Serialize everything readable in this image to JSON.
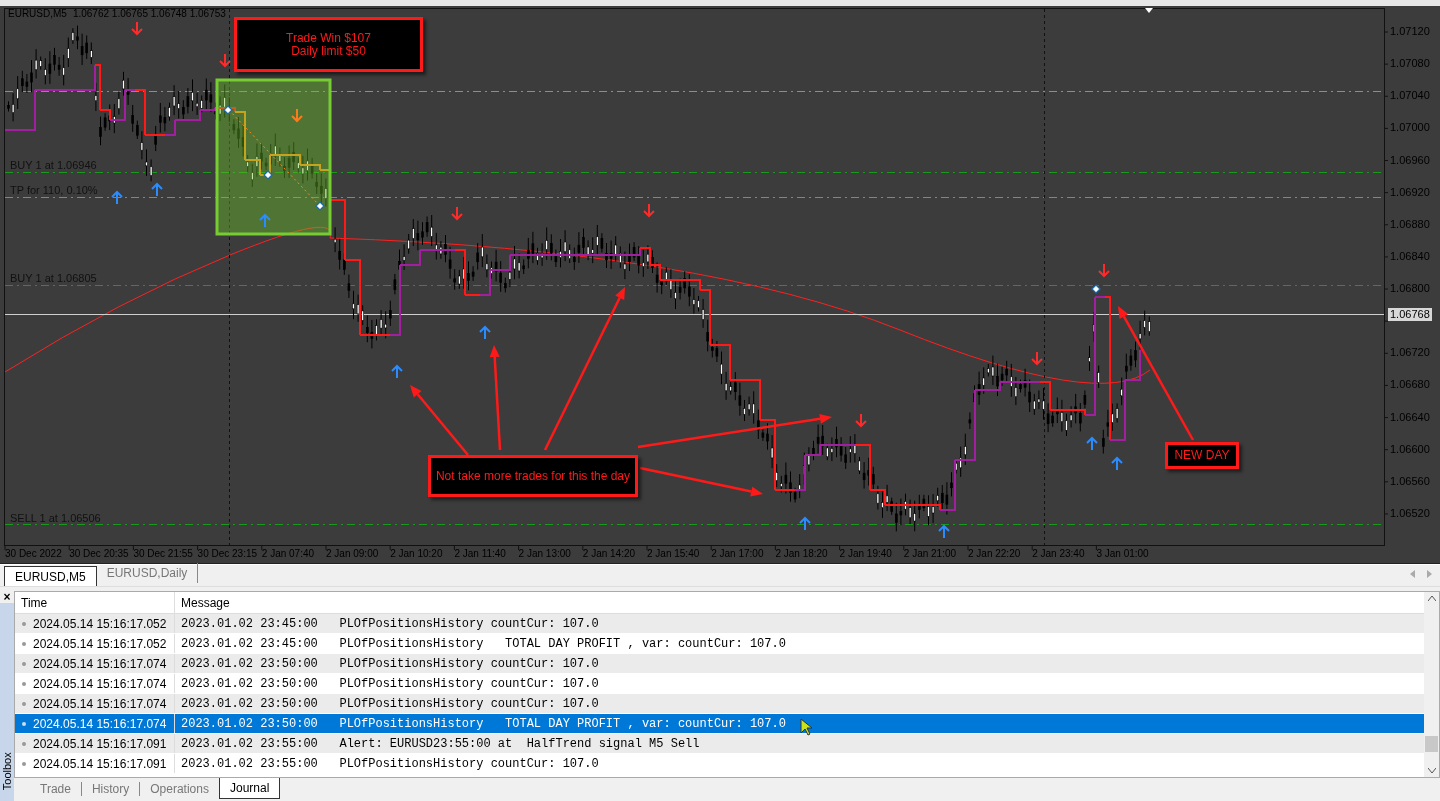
{
  "chart": {
    "symbol": "EURUSD,M5",
    "ohlc": "1.06762 1.06765 1.06748 1.06753",
    "line_labels": [
      "BUY 1 at 1.06946",
      "TP for 110, 0.10%",
      "BUY 1 at 1.06805",
      "SELL 1 at 1.06506"
    ],
    "price_labels": [
      "1.07120",
      "1.07080",
      "1.07040",
      "1.07000",
      "1.06960",
      "1.06920",
      "1.06880",
      "1.06840",
      "1.06800",
      "1.06720",
      "1.06680",
      "1.06640",
      "1.06600",
      "1.06560",
      "1.06520"
    ],
    "current_price": "1.06768",
    "time_labels": [
      "30 Dec 2022",
      "30 Dec 20:35",
      "30 Dec 21:55",
      "30 Dec 23:15",
      "2 Jan 07:40",
      "2 Jan 09:00",
      "2 Jan 10:20",
      "2 Jan 11:40",
      "2 Jan 13:00",
      "2 Jan 14:20",
      "2 Jan 15:40",
      "2 Jan 17:00",
      "2 Jan 18:20",
      "2 Jan 19:40",
      "2 Jan 21:00",
      "2 Jan 22:20",
      "2 Jan 23:40",
      "3 Jan 01:00"
    ],
    "notes": [
      {
        "lines": [
          "Trade Win $107",
          "Daily limit $50"
        ]
      },
      {
        "lines": [
          "Not take more trades for this the day"
        ]
      },
      {
        "lines": [
          "NEW DAY"
        ]
      }
    ]
  },
  "chart_tabs": [
    {
      "label": "EURUSD,M5",
      "selected": true
    },
    {
      "label": "EURUSD,Daily",
      "selected": false
    }
  ],
  "toolbox": {
    "title": "Toolbox",
    "close": "×",
    "columns": [
      "Time",
      "Message"
    ],
    "rows": [
      {
        "time": "2024.05.14 15:16:17.052",
        "message": "2023.01.02 23:45:00   PLOfPositionsHistory countCur: 107.0",
        "selected": false
      },
      {
        "time": "2024.05.14 15:16:17.052",
        "message": "2023.01.02 23:45:00   PLOfPositionsHistory   TOTAL DAY PROFIT , var: countCur: 107.0",
        "selected": false
      },
      {
        "time": "2024.05.14 15:16:17.074",
        "message": "2023.01.02 23:50:00   PLOfPositionsHistory countCur: 107.0",
        "selected": false
      },
      {
        "time": "2024.05.14 15:16:17.074",
        "message": "2023.01.02 23:50:00   PLOfPositionsHistory countCur: 107.0",
        "selected": false
      },
      {
        "time": "2024.05.14 15:16:17.074",
        "message": "2023.01.02 23:50:00   PLOfPositionsHistory countCur: 107.0",
        "selected": false
      },
      {
        "time": "2024.05.14 15:16:17.074",
        "message": "2023.01.02 23:50:00   PLOfPositionsHistory   TOTAL DAY PROFIT , var: countCur: 107.0",
        "selected": true
      },
      {
        "time": "2024.05.14 15:16:17.091",
        "message": "2023.01.02 23:55:00   Alert: EURUSD23:55:00 at  HalfTrend signal M5 Sell",
        "selected": false
      },
      {
        "time": "2024.05.14 15:16:17.091",
        "message": "2023.01.02 23:55:00   PLOfPositionsHistory countCur: 107.0",
        "selected": false
      }
    ],
    "tabs": [
      {
        "label": "Trade",
        "selected": false
      },
      {
        "label": "History",
        "selected": false
      },
      {
        "label": "Operations",
        "selected": false
      },
      {
        "label": "Journal",
        "selected": true
      }
    ]
  }
}
